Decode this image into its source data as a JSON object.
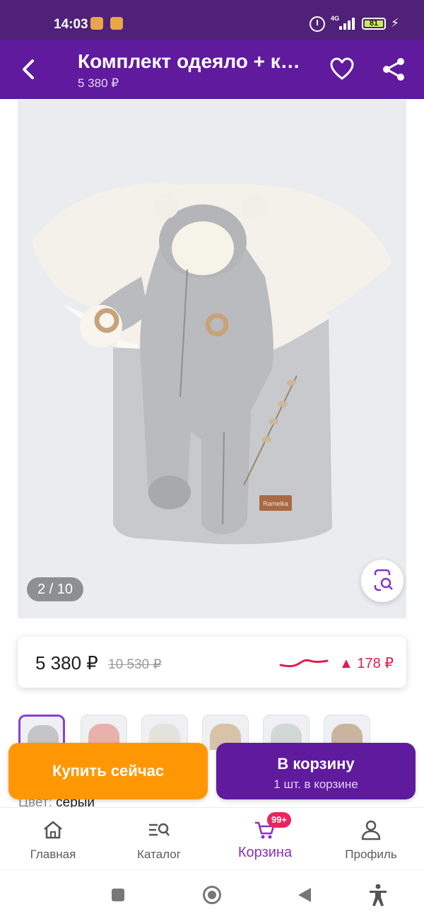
{
  "status_bar": {
    "time": "14:03",
    "network": "4G",
    "battery": "81",
    "icons": [
      "emoji-icon",
      "emoji-icon",
      "alarm-icon",
      "signal-icon",
      "battery-icon",
      "charging-icon"
    ]
  },
  "header": {
    "title": "Комплект одеяло + к…",
    "price": "5 380 ₽",
    "icons": [
      "back-icon",
      "heart-icon",
      "share-icon"
    ]
  },
  "gallery": {
    "counter": "2 / 10",
    "brand_tag": "Ramelka",
    "icons": [
      "visual-search-icon"
    ]
  },
  "price_card": {
    "price": "5 380 ₽",
    "old_price": "10 530 ₽",
    "change": "▲ 178 ₽",
    "colors": {
      "accent": "#e21d4b"
    }
  },
  "thumbnails": {
    "count_visible": 6,
    "selected_index": 0
  },
  "details": {
    "color_label": "Цвет:",
    "color_value": "серый"
  },
  "actions": {
    "buy_now": "Купить сейчас",
    "add_to_cart": "В корзину",
    "in_cart": "1 шт. в корзине"
  },
  "bottom_nav": {
    "items": [
      {
        "label": "Главная",
        "icon": "home-icon"
      },
      {
        "label": "Каталог",
        "icon": "catalog-search-icon"
      },
      {
        "label": "Корзина",
        "icon": "cart-icon",
        "badge": "99+"
      },
      {
        "label": "Профиль",
        "icon": "profile-icon"
      }
    ],
    "active_index": 2
  },
  "system_nav": {
    "icons": [
      "recents-icon",
      "home-circle-icon",
      "back-triangle-icon",
      "accessibility-icon"
    ]
  },
  "colors": {
    "status_bar": "#4f2178",
    "header": "#5f1a9e",
    "buy_button": "#ff9704",
    "cart_button": "#5f1a9e",
    "active_nav": "#8b2fc9",
    "badge": "#e8265e"
  }
}
